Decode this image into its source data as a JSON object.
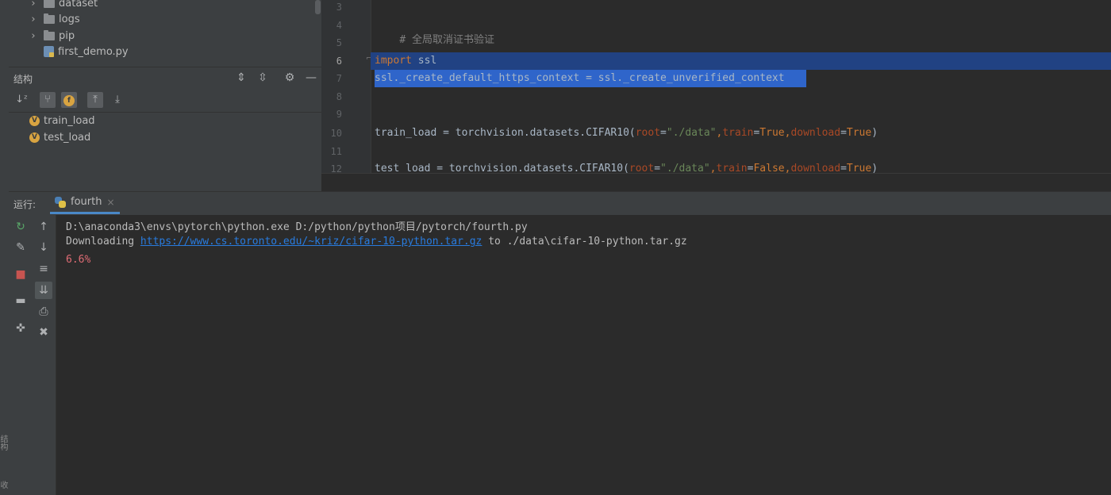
{
  "project_tree": {
    "items": [
      {
        "label": "dataset",
        "type": "folder",
        "expandable": true
      },
      {
        "label": "logs",
        "type": "folder",
        "expandable": true
      },
      {
        "label": "pip",
        "type": "folder",
        "expandable": true
      },
      {
        "label": "first_demo.py",
        "type": "python-file",
        "expandable": false
      }
    ]
  },
  "structure": {
    "title": "结构",
    "items": [
      {
        "label": "train_load",
        "badge": "V"
      },
      {
        "label": "test_load",
        "badge": "V"
      }
    ],
    "filter_badge": "f"
  },
  "editor": {
    "lines": [
      {
        "num": "3",
        "code": ""
      },
      {
        "num": "4",
        "code": "# 全局取消证书验证"
      },
      {
        "num": "5",
        "code": ""
      },
      {
        "num": "6",
        "code": "import ssl"
      },
      {
        "num": "7",
        "code": "ssl._create_default_https_context = ssl._create_unverified_context"
      },
      {
        "num": "8",
        "code": ""
      },
      {
        "num": "9",
        "code": ""
      },
      {
        "num": "10",
        "code": "train_load = torchvision.datasets.CIFAR10(root=\"./data\",train=True,download=True)"
      },
      {
        "num": "11",
        "code": ""
      },
      {
        "num": "12",
        "code": "test_load = torchvision.datasets.CIFAR10(root=\"./data\",train=False,download=True)"
      }
    ],
    "tokens": {
      "line4": "# 全局取消证书验证",
      "line6_kw": "import",
      "line6_rest": " ssl",
      "line7": "ssl._create_default_https_context = ssl._create_unverified_context",
      "line10_a": "train_load = torchvision.datasets.CIFAR10(",
      "line10_root": "root",
      "line10_eq": "=",
      "line10_str": "\"./data\"",
      "line10_comma1": ",",
      "line10_train": "train",
      "line10_eq2": "=",
      "line10_true1": "True",
      "line10_comma2": ",",
      "line10_dl": "download",
      "line10_eq3": "=",
      "line10_true2": "True",
      "line10_close": ")",
      "line12_a": "test_load = torchvision.datasets.CIFAR10(",
      "line12_root": "root",
      "line12_eq": "=",
      "line12_str": "\"./data\"",
      "line12_comma1": ",",
      "line12_train": "train",
      "line12_eq2": "=",
      "line12_false": "False",
      "line12_comma2": ",",
      "line12_dl": "download",
      "line12_eq3": "=",
      "line12_true": "True",
      "line12_close": ")"
    }
  },
  "run": {
    "label": "运行:",
    "tab_name": "fourth",
    "tab_close": "×",
    "console": {
      "line1": "D:\\anaconda3\\envs\\pytorch\\python.exe D:/python/python项目/pytorch/fourth.py",
      "line2_prefix": "Downloading ",
      "line2_link": "https://www.cs.toronto.edu/~kriz/cifar-10-python.tar.gz",
      "line2_suffix": " to ./data\\cifar-10-python.tar.gz",
      "progress": "6.6%"
    }
  },
  "left_strip": {
    "tab1": "结构",
    "tab2": "收"
  },
  "colors": {
    "keyword": "#cc7832",
    "string": "#6a8759",
    "param": "#aa4926",
    "selection": "#214283",
    "link": "#287bde",
    "progress": "#e06c75"
  }
}
